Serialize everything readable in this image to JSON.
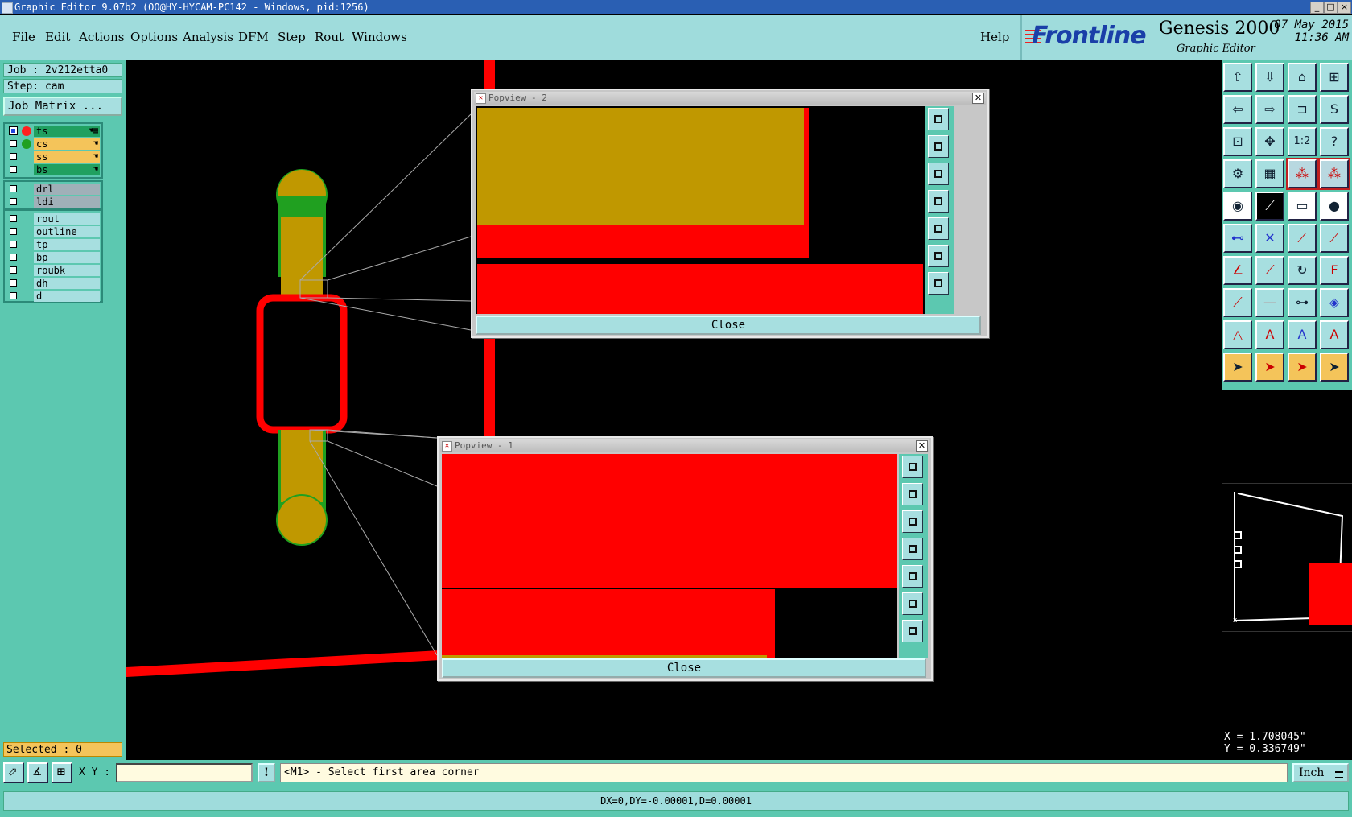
{
  "window": {
    "title": "Graphic Editor 9.07b2 (OO@HY-HYCAM-PC142 - Windows, pid:1256)"
  },
  "menu": {
    "items": [
      "File",
      "Edit",
      "Actions",
      "Options",
      "Analysis",
      "DFM",
      "Step",
      "Rout",
      "Windows"
    ],
    "help": "Help"
  },
  "logo": {
    "brand": "Frontline",
    "product": "Genesis 2000",
    "subtitle": "Graphic Editor",
    "date": "07 May 2015",
    "time": "11:36 AM"
  },
  "job": {
    "job_label": "Job : 2v212etta0",
    "step_label": "Step: cam",
    "job_matrix_button": "Job Matrix ..."
  },
  "layers": {
    "board": [
      {
        "name": "ts",
        "color": "#20a060",
        "dot": "#ff2020",
        "active": true
      },
      {
        "name": "cs",
        "color": "#f4c45a",
        "dot": "#20a020",
        "active": false
      },
      {
        "name": "ss",
        "color": "#f4c45a",
        "dot": "",
        "active": false
      },
      {
        "name": "bs",
        "color": "#20a060",
        "dot": "",
        "active": false
      }
    ],
    "drill": [
      {
        "name": "drl",
        "color": "#a0b0b8"
      },
      {
        "name": "ldi",
        "color": "#a0b0b8"
      }
    ],
    "misc": [
      {
        "name": "rout"
      },
      {
        "name": "outline"
      },
      {
        "name": "tp"
      },
      {
        "name": "bp"
      },
      {
        "name": "roubk"
      },
      {
        "name": "dh"
      },
      {
        "name": "d"
      }
    ]
  },
  "selected": "Selected : 0",
  "popview2": {
    "title": "Popview - 2",
    "close": "Close"
  },
  "popview1": {
    "title": "Popview - 1",
    "close": "Close"
  },
  "coords": {
    "x": "X = 1.708045\"",
    "y": "Y = 0.336749\""
  },
  "bottom": {
    "xy_label": "X Y :",
    "xy_value": "",
    "prompt": "<M1> - Select first area corner",
    "unit": "Inch"
  },
  "status": {
    "text": "DX=0,DY=-0.00001,D=0.00001"
  },
  "colors": {
    "teal_panel": "#5cc8b0",
    "light_teal": "#a7dfe0",
    "feature_red": "#ff0000",
    "pad_gold": "#c09800",
    "titlebar": "#2a5fb3"
  }
}
